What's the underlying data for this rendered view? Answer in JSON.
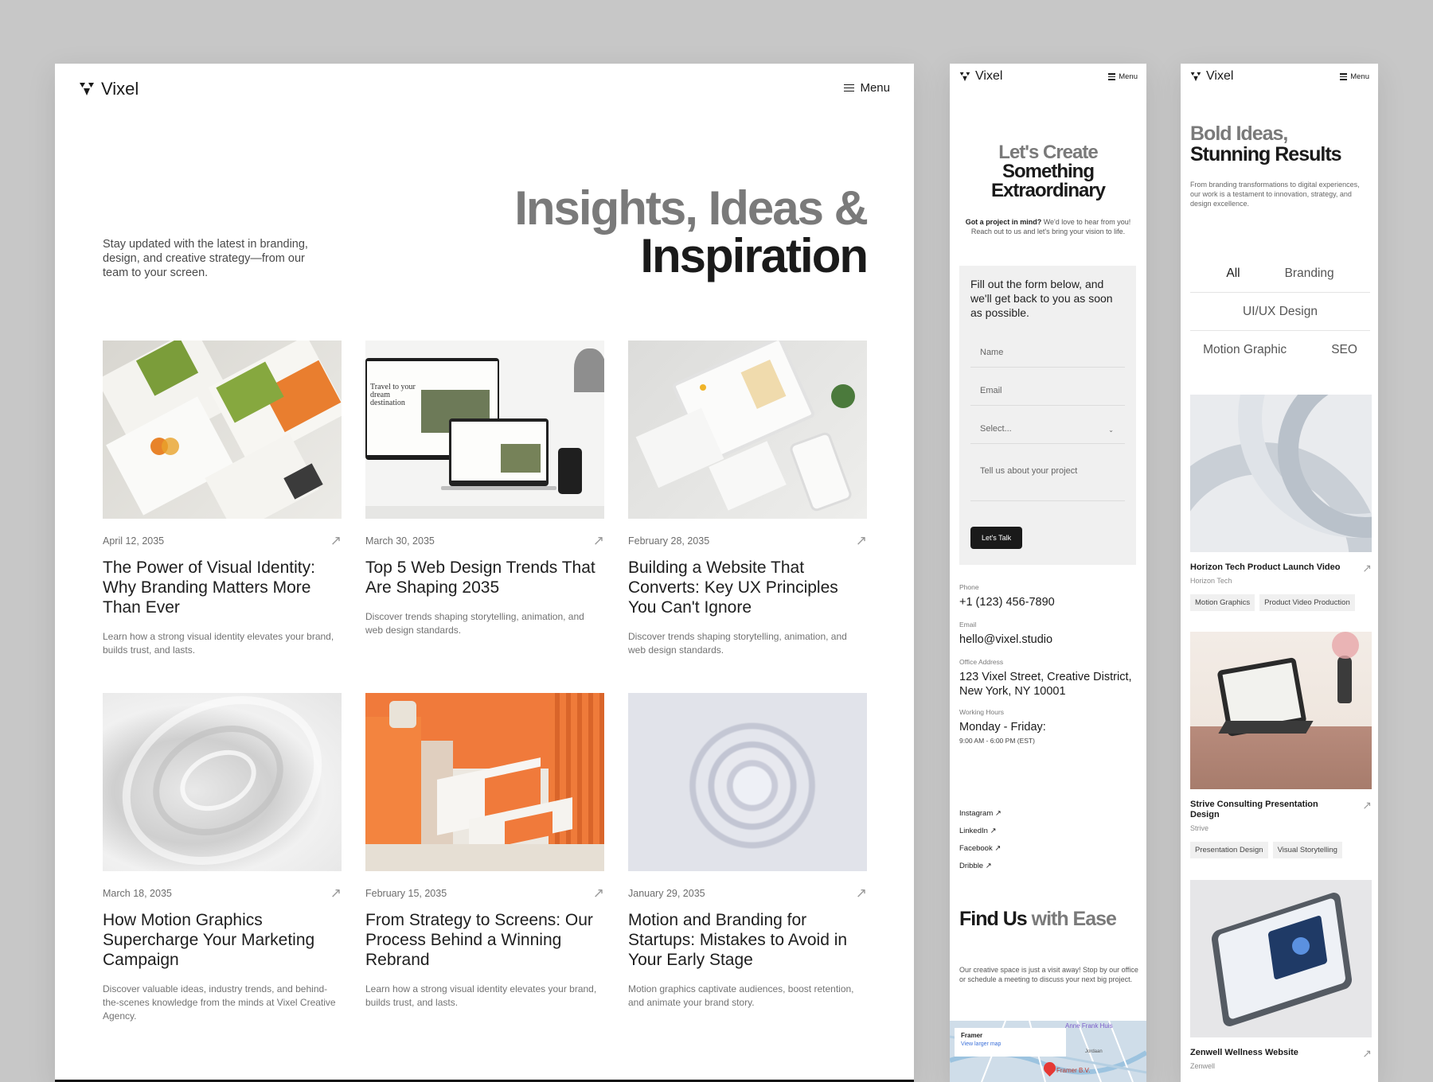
{
  "brand": {
    "name": "Vixel"
  },
  "main": {
    "menu_label": "Menu",
    "hero": {
      "title_line1": "Insights, Ideas &",
      "title_line2": "Inspiration",
      "intro": "Stay updated with the latest in branding, design, and creative strategy—from our team to your screen."
    },
    "posts": [
      {
        "date": "April 12, 2035",
        "title": "The Power of Visual Identity: Why Branding Matters More Than Ever",
        "desc": "Learn how a strong visual identity elevates your brand, builds trust, and lasts."
      },
      {
        "date": "March 30, 2035",
        "title": "Top 5 Web Design Trends That Are Shaping 2035",
        "desc": "Discover trends shaping storytelling, animation, and web design standards."
      },
      {
        "date": "February 28, 2035",
        "title": "Building a Website That Converts: Key UX Principles You Can't Ignore",
        "desc": "Discover trends shaping storytelling, animation, and web design standards."
      },
      {
        "date": "March 18, 2035",
        "title": "How Motion Graphics Supercharge Your Marketing Campaign",
        "desc": "Discover valuable ideas, industry trends, and behind-the-scenes knowledge from the minds at Vixel Creative Agency."
      },
      {
        "date": "February 15, 2035",
        "title": "From Strategy to Screens: Our Process Behind a Winning Rebrand",
        "desc": "Learn how a strong visual identity elevates your brand, builds trust, and lasts."
      },
      {
        "date": "January 29, 2035",
        "title": "Motion and Branding for Startups: Mistakes to Avoid in Your Early Stage",
        "desc": "Motion graphics captivate audiences, boost retention, and animate your brand story."
      }
    ],
    "thumb_texts": {
      "travel": "Travel to your dream destination"
    }
  },
  "contact": {
    "menu_label": "Menu",
    "title_line1": "Let's Create",
    "title_line2": "Something",
    "title_line3": "Extraordinary",
    "sub_bold": "Got a project in mind?",
    "sub_rest": " We'd love to hear from you! Reach out to us and let's bring your vision to life.",
    "form": {
      "title": "Fill out the form below, and we'll get back to you as soon as possible.",
      "name_placeholder": "Name",
      "email_placeholder": "Email",
      "select_value": "Select...",
      "message_placeholder": "Tell us about your project",
      "submit": "Let's Talk"
    },
    "phone_label": "Phone",
    "phone": "+1 (123) 456-7890",
    "email_label": "Email",
    "email": "hello@vixel.studio",
    "address_label": "Office Address",
    "address": "123 Vixel Street, Creative District, New York, NY 10001",
    "hours_label": "Working Hours",
    "hours_days": "Monday - Friday:",
    "hours_time": "9:00 AM - 6:00 PM (EST)",
    "socials": [
      "Instagram",
      "LinkedIn",
      "Facebook",
      "Dribble"
    ],
    "find_title_dark": "Find Us",
    "find_title_gray": " with Ease",
    "find_sub": "Our creative space is just a visit away! Stop by our office or schedule a meeting to discuss your next big project.",
    "map": {
      "place": "Framer",
      "larger": "View larger map",
      "poi1": "Anne Frank Huis",
      "poi2": "Jordaan",
      "poi3": "Framer B.V."
    }
  },
  "work": {
    "menu_label": "Menu",
    "title_line1": "Bold Ideas,",
    "title_line2": "Stunning Results",
    "sub": "From branding transformations to digital experiences, our work is a testament to innovation, strategy, and design excellence.",
    "filters": [
      "All",
      "Branding",
      "UI/UX Design",
      "Motion Graphic",
      "SEO"
    ],
    "projects": [
      {
        "name": "Horizon Tech Product Launch Video",
        "client": "Horizon Tech",
        "tags": [
          "Motion Graphics",
          "Product Video Production"
        ]
      },
      {
        "name": "Strive Consulting Presentation Design",
        "client": "Strive",
        "tags": [
          "Presentation Design",
          "Visual Storytelling"
        ]
      },
      {
        "name": "Zenwell Wellness Website",
        "client": "Zenwell",
        "tags": []
      }
    ]
  }
}
